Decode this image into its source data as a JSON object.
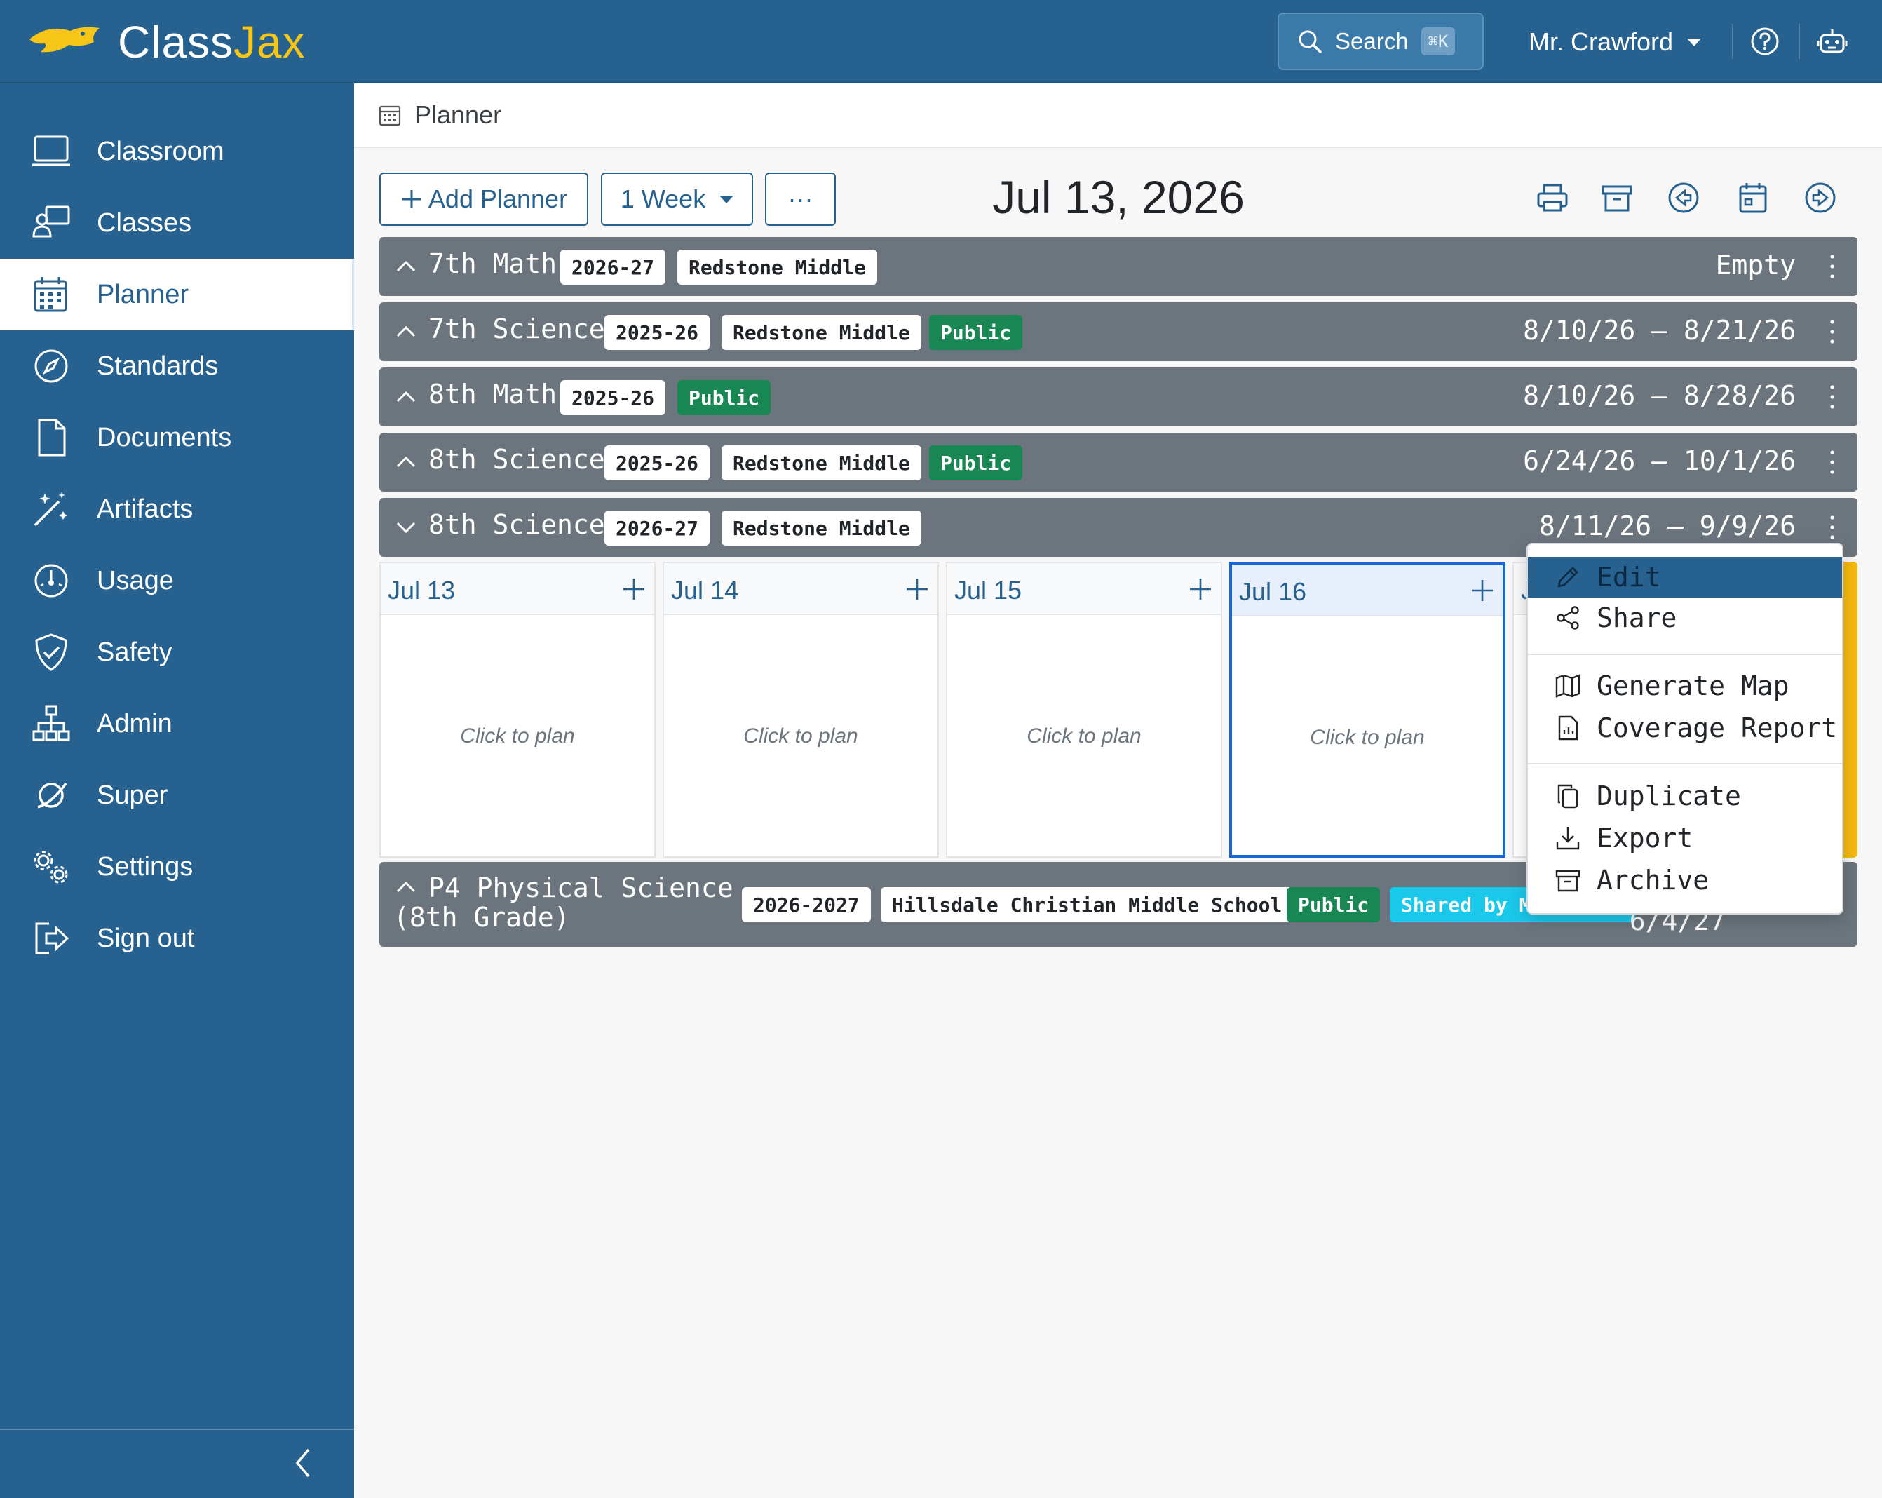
{
  "app": {
    "brand_prefix": "Class",
    "brand_suffix": "Jax",
    "accent_color": "#f5c518",
    "primary_color": "#26618f"
  },
  "topbar": {
    "search_label": "Search",
    "search_shortcut": "⌘K",
    "user_name": "Mr. Crawford"
  },
  "sidebar": {
    "items": [
      {
        "label": "Classroom",
        "icon": "classroom-icon"
      },
      {
        "label": "Classes",
        "icon": "classes-icon"
      },
      {
        "label": "Planner",
        "icon": "calendar-icon",
        "active": true
      },
      {
        "label": "Standards",
        "icon": "compass-icon"
      },
      {
        "label": "Documents",
        "icon": "document-icon"
      },
      {
        "label": "Artifacts",
        "icon": "magic-wand-icon"
      },
      {
        "label": "Usage",
        "icon": "speedometer-icon"
      },
      {
        "label": "Safety",
        "icon": "shield-check-icon"
      },
      {
        "label": "Admin",
        "icon": "diagram-icon"
      },
      {
        "label": "Super",
        "icon": "super-icon"
      },
      {
        "label": "Settings",
        "icon": "gears-icon"
      },
      {
        "label": "Sign out",
        "icon": "sign-out-icon"
      }
    ]
  },
  "breadcrumb": {
    "label": "Planner"
  },
  "toolbar": {
    "add_planner": "Add Planner",
    "view_range": "1 Week",
    "more_label": "···",
    "current_date": "Jul 13, 2026"
  },
  "planners": [
    {
      "name": "7th Math",
      "tags": [
        {
          "text": "2026-27",
          "style": "white"
        },
        {
          "text": "Redstone Middle",
          "style": "white"
        }
      ],
      "dates": "Empty",
      "expanded": false
    },
    {
      "name": "7th Science",
      "tags": [
        {
          "text": "2025-26",
          "style": "white"
        },
        {
          "text": "Redstone Middle",
          "style": "white"
        },
        {
          "text": "Public",
          "style": "green"
        }
      ],
      "dates": "8/10/26 – 8/21/26",
      "expanded": false
    },
    {
      "name": "8th Math",
      "tags": [
        {
          "text": "2025-26",
          "style": "white"
        },
        {
          "text": "Public",
          "style": "green"
        }
      ],
      "dates": "8/10/26 – 8/28/26",
      "expanded": false
    },
    {
      "name": "8th Science",
      "tags": [
        {
          "text": "2025-26",
          "style": "white"
        },
        {
          "text": "Redstone Middle",
          "style": "white"
        },
        {
          "text": "Public",
          "style": "green"
        }
      ],
      "dates": "6/24/26 – 10/1/26",
      "expanded": false
    },
    {
      "name": "8th Science",
      "tags": [
        {
          "text": "2026-27",
          "style": "white"
        },
        {
          "text": "Redstone Middle",
          "style": "white"
        }
      ],
      "dates": "8/11/26 – 9/9/26",
      "expanded": true
    },
    {
      "name_line1": "P4 Physical Science",
      "name_line2": "(8th Grade)",
      "tags": [
        {
          "text": "2026-2027",
          "style": "white"
        },
        {
          "text": "Hillsdale Christian Middle School",
          "style": "white"
        },
        {
          "text": "Public",
          "style": "green"
        },
        {
          "text": "Shared by M",
          "style": "cyan"
        }
      ],
      "dates": "6/4/27",
      "expanded": false
    }
  ],
  "week_days": [
    {
      "label": "Jul 13",
      "placeholder": "Click to plan"
    },
    {
      "label": "Jul 14",
      "placeholder": "Click to plan"
    },
    {
      "label": "Jul 15",
      "placeholder": "Click to plan"
    },
    {
      "label": "Jul 16",
      "placeholder": "Click to plan",
      "today": true
    }
  ],
  "hidden_day_partial": "J",
  "context_menu": {
    "groups": [
      [
        {
          "label": "Edit",
          "icon": "pencil-icon",
          "highlighted": true
        },
        {
          "label": "Share",
          "icon": "share-icon"
        }
      ],
      [
        {
          "label": "Generate Map",
          "icon": "map-icon"
        },
        {
          "label": "Coverage Report",
          "icon": "report-icon"
        }
      ],
      [
        {
          "label": "Duplicate",
          "icon": "copy-icon"
        },
        {
          "label": "Export",
          "icon": "download-icon"
        },
        {
          "label": "Archive",
          "icon": "archive-icon"
        }
      ]
    ]
  }
}
